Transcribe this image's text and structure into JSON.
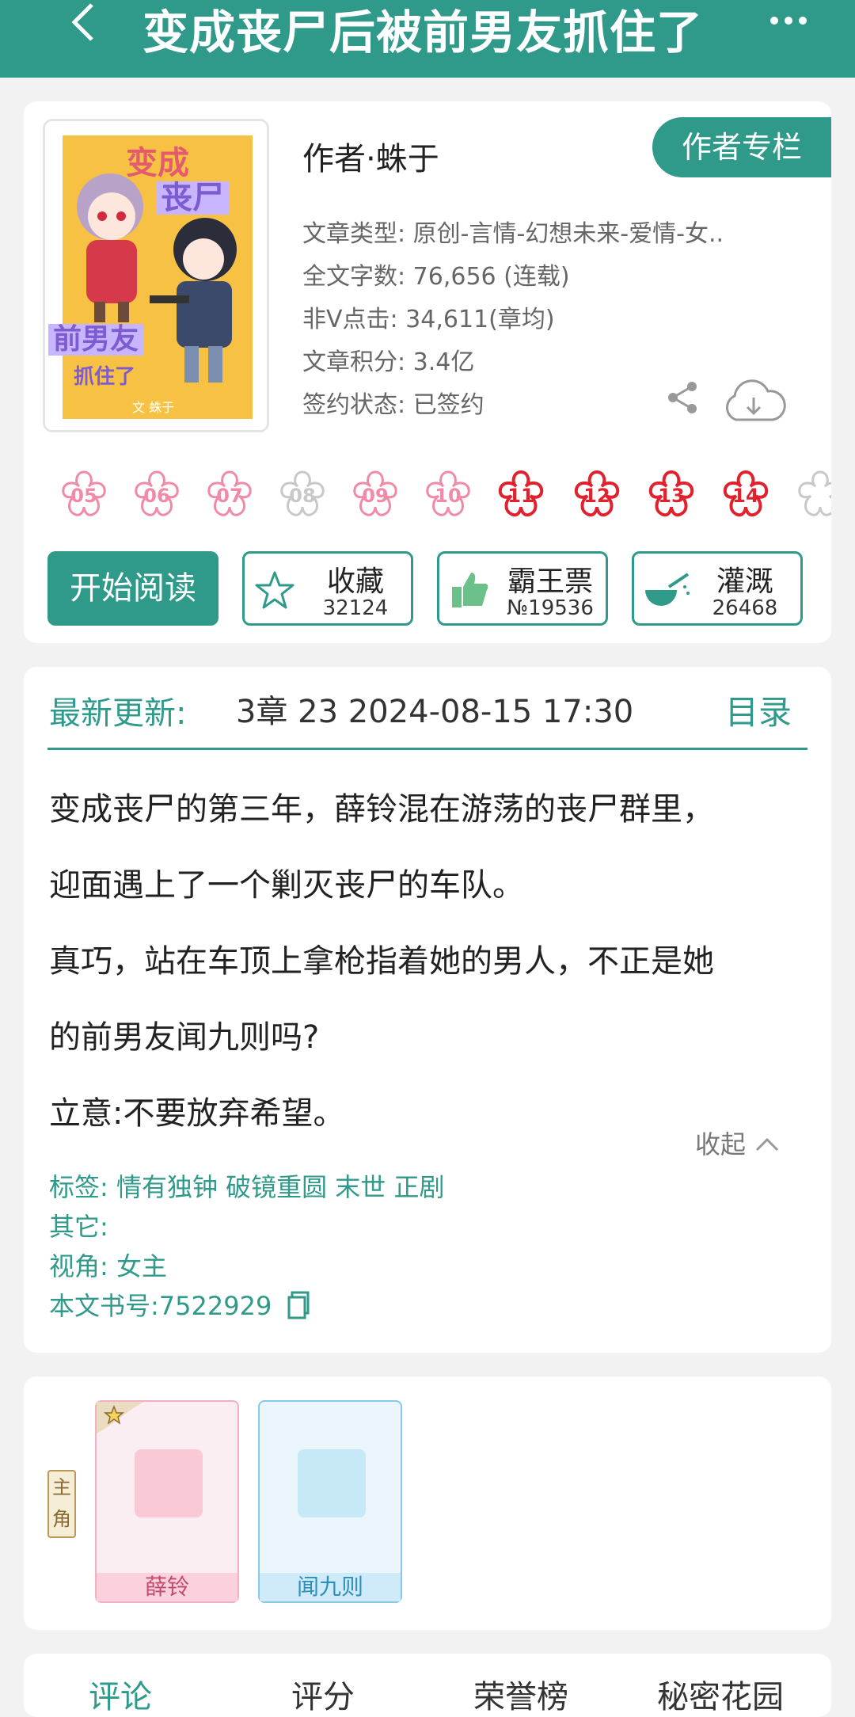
{
  "header": {
    "title": "变成丧尸后被前男友抓住了"
  },
  "book": {
    "cover_title_1": "变成",
    "cover_title_2": "丧尸",
    "cover_title_3": "前男友",
    "cover_title_4": "抓住了",
    "cover_author": "文 蛛于",
    "author": "作者·蛛于",
    "author_column_label": "作者专栏",
    "meta": [
      "文章类型: 原创-言情-幻想未来-爱情-女..",
      "全文字数: 76,656 (连载)",
      "非Ⅴ点击: 34,611(章均)",
      "文章积分: 3.4亿",
      "签约状态: 已签约"
    ]
  },
  "flowers": [
    {
      "num": "05",
      "style": "pink"
    },
    {
      "num": "06",
      "style": "pink"
    },
    {
      "num": "07",
      "style": "pink"
    },
    {
      "num": "08",
      "style": "gray"
    },
    {
      "num": "09",
      "style": "pink"
    },
    {
      "num": "10",
      "style": "pink"
    },
    {
      "num": "11",
      "style": "red"
    },
    {
      "num": "12",
      "style": "red"
    },
    {
      "num": "13",
      "style": "red"
    },
    {
      "num": "14",
      "style": "red"
    }
  ],
  "actions": {
    "read_label": "开始阅读",
    "favorite": {
      "label": "收藏",
      "count": "32124"
    },
    "vote": {
      "label": "霸王票",
      "count": "№19536"
    },
    "water": {
      "label": "灌溉",
      "count": "26468"
    }
  },
  "update": {
    "label": "最新更新:",
    "value": "3章  23  2024-08-15 17:30",
    "catalog_label": "目录"
  },
  "summary": {
    "lines": [
      "变成丧尸的第三年，薛铃混在游荡的丧尸群里，",
      "迎面遇上了一个剿灭丧尸的车队。",
      "真巧，站在车顶上拿枪指着她的男人，不正是她",
      "的前男友闻九则吗?",
      "立意:不要放弃希望。"
    ],
    "collapse_label": "收起"
  },
  "tags": {
    "tags_line": "标签: 情有独钟 破镜重圆 末世 正剧",
    "other_line": "其它:",
    "view_line": "视角: 女主",
    "book_no_line": "本文书号:7522929"
  },
  "characters": {
    "role_badge": "主角",
    "items": [
      {
        "name": "薛铃"
      },
      {
        "name": "闻九则"
      }
    ]
  },
  "tabs": [
    "评论",
    "评分",
    "荣誉榜",
    "秘密花园"
  ],
  "colors": {
    "accent": "#2f9a8a",
    "flower_pink": "#f08aa6",
    "flower_red": "#e0212e",
    "flower_gray": "#c8c8c8"
  }
}
